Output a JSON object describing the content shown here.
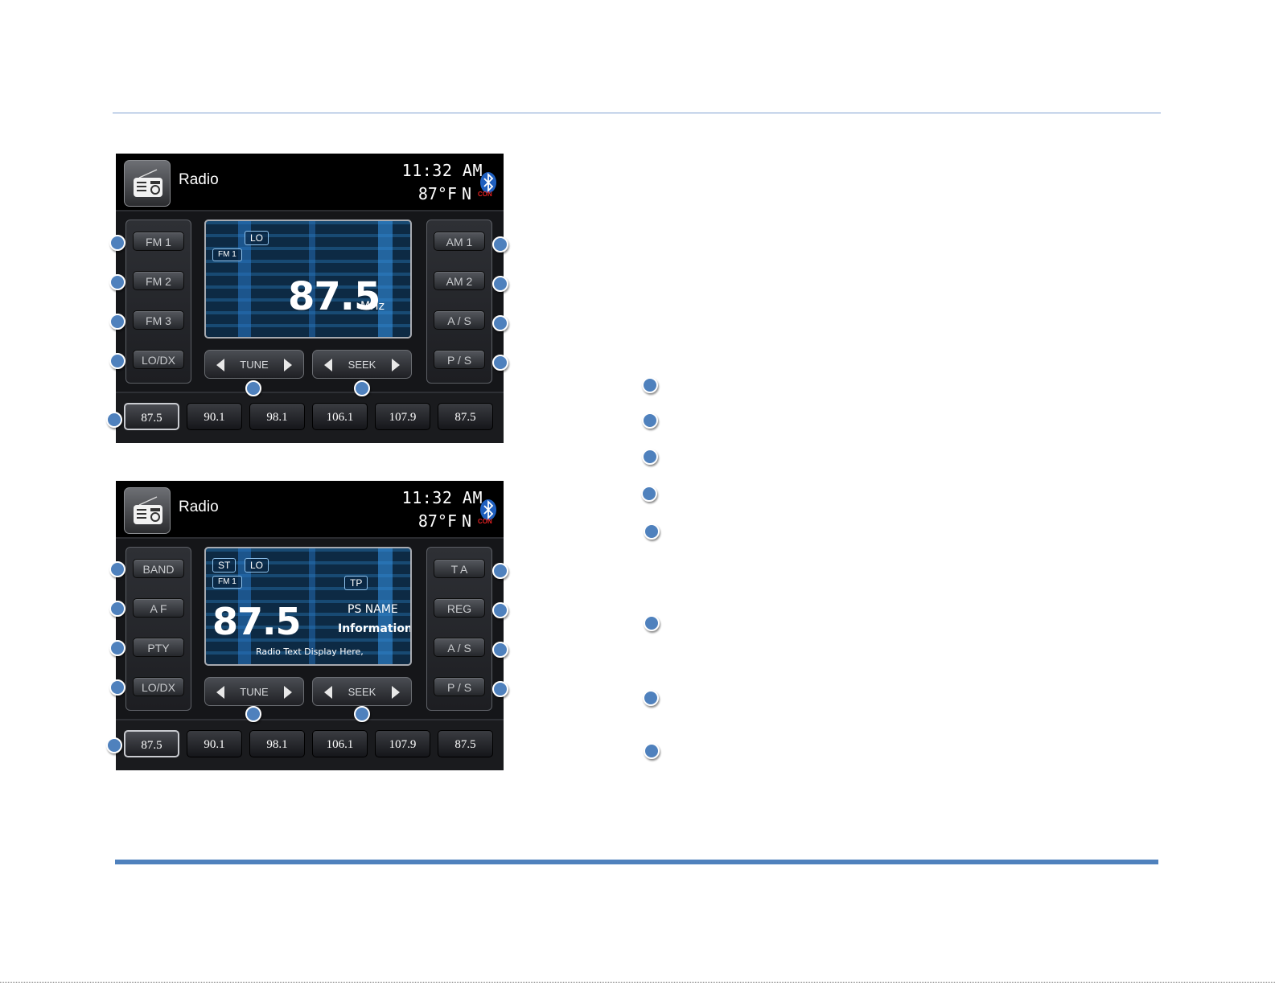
{
  "screens": [
    {
      "header": {
        "title": "Radio",
        "time": "11:32 AM",
        "temp": "87°F",
        "direction": "N",
        "bt_status": "CON"
      },
      "left_buttons": [
        "FM 1",
        "FM 2",
        "FM 3",
        "LO/DX"
      ],
      "right_buttons": [
        "AM 1",
        "AM 2",
        "A / S",
        "P / S"
      ],
      "display": {
        "tag_lo": "LO",
        "tag_band": "FM 1",
        "frequency": "87.5",
        "unit": "MHz"
      },
      "tune_label": "TUNE",
      "seek_label": "SEEK",
      "presets": [
        "87.5",
        "90.1",
        "98.1",
        "106.1",
        "107.9",
        "87.5"
      ]
    },
    {
      "header": {
        "title": "Radio",
        "time": "11:32 AM",
        "temp": "87°F",
        "direction": "N",
        "bt_status": "CON"
      },
      "left_buttons": [
        "BAND",
        "A F",
        "PTY",
        "LO/DX"
      ],
      "right_buttons": [
        "T A",
        "REG",
        "A / S",
        "P / S"
      ],
      "display": {
        "tag_st": "ST",
        "tag_lo": "LO",
        "tag_band": "FM 1",
        "tag_tp": "TP",
        "frequency": "87.5",
        "ps_name": "PS NAME",
        "info": "Information",
        "radio_text": "Radio Text Display Here,"
      },
      "tune_label": "TUNE",
      "seek_label": "SEEK",
      "presets": [
        "87.5",
        "90.1",
        "98.1",
        "106.1",
        "107.9",
        "87.5"
      ]
    }
  ],
  "colors": {
    "marker": "#4f81bd",
    "rule": "#4f81bd",
    "display_tag_border": "#8fc3ee"
  },
  "icons": [
    "radio-icon",
    "bluetooth-icon",
    "arrow-left-icon",
    "arrow-right-icon"
  ]
}
